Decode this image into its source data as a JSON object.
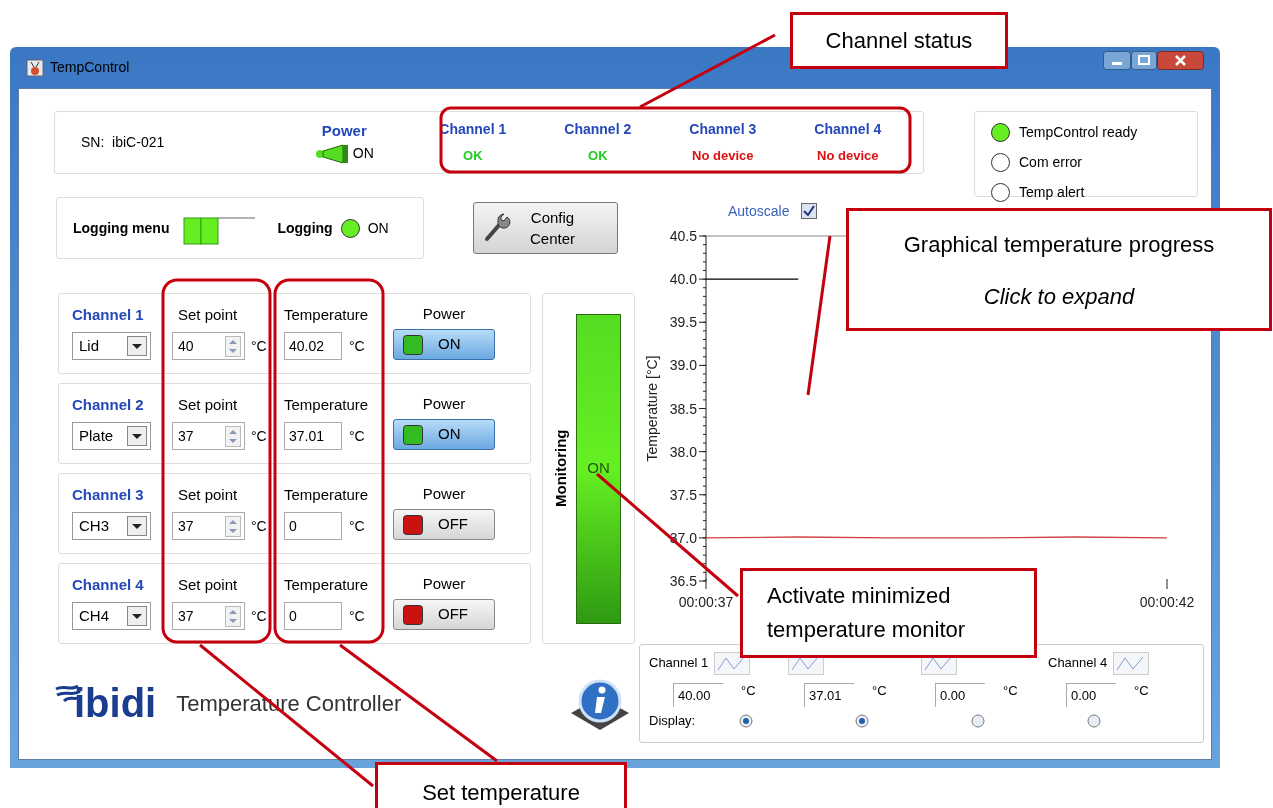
{
  "window": {
    "title": "TempControl"
  },
  "device": {
    "serial_label": "SN:",
    "serial": "ibiC-021",
    "power_label": "Power",
    "power_on": true,
    "power_text": "ON"
  },
  "channel_status": [
    {
      "name": "Channel 1",
      "status": "OK",
      "ok": true
    },
    {
      "name": "Channel 2",
      "status": "OK",
      "ok": true
    },
    {
      "name": "Channel 3",
      "status": "No device",
      "ok": false
    },
    {
      "name": "Channel 4",
      "status": "No device",
      "ok": false
    }
  ],
  "status_indicators": [
    {
      "label": "TempControl ready",
      "on": true
    },
    {
      "label": "Com error",
      "on": false
    },
    {
      "label": "Temp alert",
      "on": false
    }
  ],
  "logging": {
    "menu_label": "Logging menu",
    "menu_switch_on": true,
    "label": "Logging",
    "on": true,
    "text": "ON"
  },
  "config_button": {
    "label": "Config\nCenter"
  },
  "channels": [
    {
      "name": "Channel 1",
      "source": "Lid",
      "setpoint_label": "Set point",
      "setpoint": "40",
      "setpoint_unit": "°C",
      "temperature_label": "Temperature",
      "temperature": "40.02",
      "temperature_unit": "°C",
      "power_label": "Power",
      "on": true,
      "power_text": "ON"
    },
    {
      "name": "Channel 2",
      "source": "Plate",
      "setpoint_label": "Set point",
      "setpoint": "37",
      "setpoint_unit": "°C",
      "temperature_label": "Temperature",
      "temperature": "37.01",
      "temperature_unit": "°C",
      "power_label": "Power",
      "on": true,
      "power_text": "ON"
    },
    {
      "name": "Channel 3",
      "source": "CH3",
      "setpoint_label": "Set point",
      "setpoint": "37",
      "setpoint_unit": "°C",
      "temperature_label": "Temperature",
      "temperature": "0",
      "temperature_unit": "°C",
      "power_label": "Power",
      "on": false,
      "power_text": "OFF"
    },
    {
      "name": "Channel 4",
      "source": "CH4",
      "setpoint_label": "Set point",
      "setpoint": "37",
      "setpoint_unit": "°C",
      "temperature_label": "Temperature",
      "temperature": "0",
      "temperature_unit": "°C",
      "power_label": "Power",
      "on": false,
      "power_text": "OFF"
    }
  ],
  "monitoring": {
    "label": "Monitoring",
    "on": true,
    "text": "ON"
  },
  "branding": {
    "logo": "ibidi",
    "product": "Temperature Controller"
  },
  "autoscale": {
    "label": "Autoscale",
    "checked": true
  },
  "chart": {
    "chart_data": {
      "type": "line",
      "ylabel": "Temperature [°C]",
      "x": [
        37,
        38,
        39,
        40,
        41,
        42
      ],
      "series": [
        {
          "color": "#000000",
          "values": [
            40,
            40,
            null,
            null,
            null,
            null
          ]
        },
        {
          "color": "#d04040",
          "values": [
            37,
            37.01,
            37,
            37,
            37.01,
            37
          ]
        }
      ],
      "xlim": [
        37,
        42
      ],
      "ylim": [
        36.5,
        40.5
      ],
      "xticks": [
        {
          "value": 37,
          "label": "00:00:37"
        },
        {
          "value": 42,
          "label": "00:00:42"
        }
      ],
      "yticks": [
        {
          "value": 36.5,
          "label": "36.5"
        },
        {
          "value": 37,
          "label": "37.0"
        },
        {
          "value": 37.5,
          "label": "37.5"
        },
        {
          "value": 38,
          "label": "38.0"
        },
        {
          "value": 38.5,
          "label": "38.5"
        },
        {
          "value": 39,
          "label": "39.0"
        },
        {
          "value": 39.5,
          "label": "39.5"
        },
        {
          "value": 40,
          "label": "40.0"
        },
        {
          "value": 40.5,
          "label": "40.5"
        }
      ]
    }
  },
  "monitor_panel": {
    "display_label": "Display:",
    "channels": [
      {
        "label": "Channel 1",
        "value": "40.00",
        "unit": "°C",
        "display": true
      },
      {
        "value": "37.01",
        "unit": "°C",
        "display": true
      },
      {
        "value": "0.00",
        "unit": "°C",
        "display": false
      },
      {
        "label": "Channel 4",
        "value": "0.00",
        "unit": "°C",
        "display": false
      }
    ]
  },
  "annotations": [
    {
      "lines": [
        {
          "text": "Channel status",
          "italic": false
        }
      ]
    },
    {
      "lines": [
        {
          "text": "Graphical temperature progress",
          "italic": false
        },
        {
          "text": "Click to expand",
          "italic": true
        }
      ]
    },
    {
      "lines": [
        {
          "text": "Activate minimized",
          "italic": false
        },
        {
          "text": "temperature monitor",
          "italic": false
        }
      ]
    },
    {
      "lines": [
        {
          "text": "Set temperature",
          "italic": false
        }
      ]
    }
  ]
}
